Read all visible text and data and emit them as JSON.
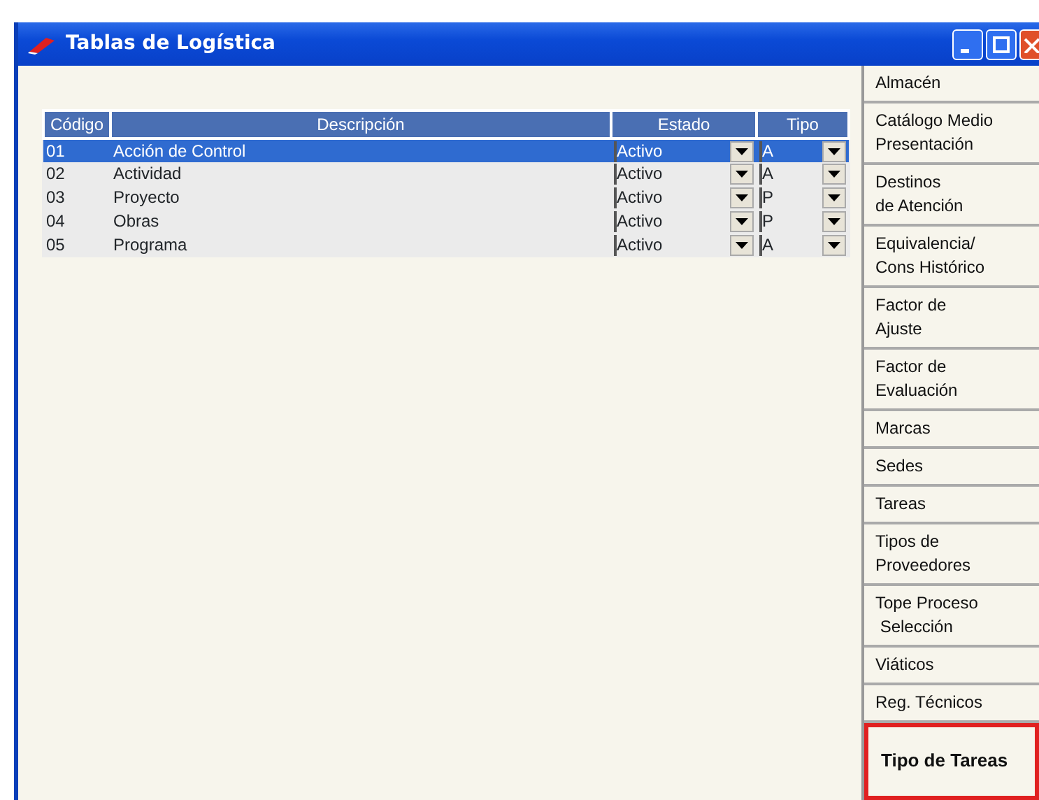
{
  "window": {
    "title": "Tablas de Logística"
  },
  "table": {
    "columns": [
      "Código",
      "Descripción",
      "Estado",
      "Tipo"
    ],
    "rows": [
      {
        "codigo": "01",
        "descripcion": "Acción de Control",
        "estado": "Activo",
        "tipo": "A",
        "selected": true
      },
      {
        "codigo": "02",
        "descripcion": "Actividad",
        "estado": "Activo",
        "tipo": "A",
        "selected": false
      },
      {
        "codigo": "03",
        "descripcion": "Proyecto",
        "estado": "Activo",
        "tipo": "P",
        "selected": false
      },
      {
        "codigo": "04",
        "descripcion": "Obras",
        "estado": "Activo",
        "tipo": "P",
        "selected": false
      },
      {
        "codigo": "05",
        "descripcion": "Programa",
        "estado": "Activo",
        "tipo": "A",
        "selected": false
      }
    ]
  },
  "sidebar": {
    "items": [
      {
        "label": "Almacén",
        "highlighted": false
      },
      {
        "label": "Catálogo Medio\nPresentación",
        "highlighted": false
      },
      {
        "label": "Destinos\nde Atención",
        "highlighted": false
      },
      {
        "label": "Equivalencia/\nCons Histórico",
        "highlighted": false
      },
      {
        "label": "Factor de\nAjuste",
        "highlighted": false
      },
      {
        "label": "Factor de\nEvaluación",
        "highlighted": false
      },
      {
        "label": "Marcas",
        "highlighted": false
      },
      {
        "label": "Sedes",
        "highlighted": false
      },
      {
        "label": "Tareas",
        "highlighted": false
      },
      {
        "label": "Tipos de\nProveedores",
        "highlighted": false
      },
      {
        "label": "Tope Proceso\n Selección",
        "highlighted": false
      },
      {
        "label": "Viáticos",
        "highlighted": false
      },
      {
        "label": "Reg. Técnicos",
        "highlighted": false
      },
      {
        "label": "Tipo de Tareas",
        "highlighted": true
      }
    ]
  }
}
